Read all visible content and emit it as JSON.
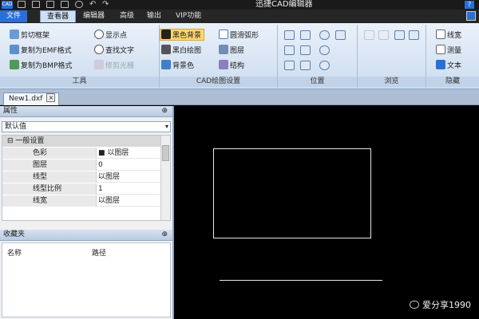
{
  "title_bar": {
    "app_icon": "CAD",
    "title": "迅捷CAD编辑器"
  },
  "menu": {
    "tabs": [
      "文件",
      "查看器",
      "编辑器",
      "高级",
      "输出",
      "VIP功能"
    ],
    "active_index": 1
  },
  "ribbon": {
    "tools_group": {
      "caption": "工具",
      "buttons": [
        "剪切框架",
        "复制为EMF格式",
        "复制为BMP格式",
        "显示点",
        "查找文字",
        "修剪光栅"
      ]
    },
    "cad_settings_group": {
      "caption": "CAD绘图设置",
      "buttons": [
        "黑色背景",
        "黑白绘图",
        "背景色",
        "圆滑弧形",
        "图层",
        "结构"
      ]
    },
    "position_group": {
      "caption": "位置"
    },
    "browse_group": {
      "caption": "浏览"
    },
    "hide_group": {
      "caption": "隐藏",
      "buttons": [
        "线宽",
        "测量",
        "文本"
      ]
    }
  },
  "doc_tab": {
    "label": "New1.dxf"
  },
  "properties": {
    "header": "属性",
    "dropdown_value": "默认值",
    "category": "一般设置",
    "rows": [
      {
        "name": "色彩",
        "value": "■ 以图层"
      },
      {
        "name": "图层",
        "value": "0"
      },
      {
        "name": "线型",
        "value": "以图层"
      },
      {
        "name": "线型比例",
        "value": "1"
      },
      {
        "name": "线宽",
        "value": "以图层"
      }
    ]
  },
  "favorites": {
    "header": "收藏夹",
    "col_name": "名称",
    "col_path": "路径"
  },
  "watermark": "爱分享1990",
  "colors": {
    "canvas": "#000000",
    "ribbon_accent": "#2a6fd6",
    "selected": "#ffd86e"
  },
  "chrome": {
    "pin_glyph": "⊕",
    "close_glyph": "×",
    "dropdown_arrow": "▾",
    "collapse_glyph": "⊟",
    "help_glyph": "?"
  }
}
